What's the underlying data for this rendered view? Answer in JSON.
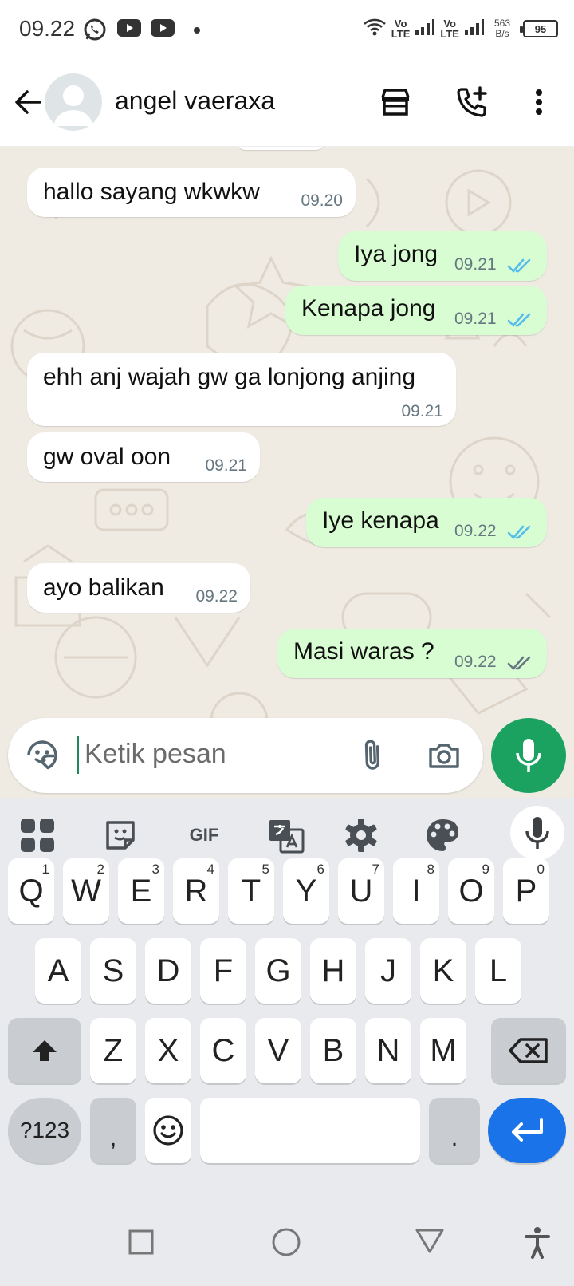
{
  "status_bar": {
    "time": "09.22",
    "volte1": "Vo",
    "lte1": "LTE",
    "volte2": "Vo",
    "lte2": "LTE",
    "net_speed_value": "563",
    "net_speed_unit": "B/s",
    "battery": "95",
    "notification_icons": [
      "whatsapp-icon",
      "youtube-icon",
      "youtube-icon",
      "dot-icon"
    ]
  },
  "header": {
    "contact_name": "angel vaeraxa",
    "icons": [
      "back-arrow-icon",
      "avatar-icon",
      "store-icon",
      "add-call-icon",
      "more-vert-icon"
    ]
  },
  "messages": [
    {
      "direction": "in",
      "text": "hallo sayang wkwkw",
      "time": "09.20"
    },
    {
      "direction": "out",
      "text": "Iya jong",
      "time": "09.21",
      "status": "read"
    },
    {
      "direction": "out",
      "text": "Kenapa jong",
      "time": "09.21",
      "status": "read"
    },
    {
      "direction": "in",
      "text": "ehh anj wajah gw ga lonjong anjing",
      "time": "09.21"
    },
    {
      "direction": "in",
      "text": "gw oval oon",
      "time": "09.21"
    },
    {
      "direction": "out",
      "text": "Iye kenapa",
      "time": "09.22",
      "status": "read"
    },
    {
      "direction": "in",
      "text": "ayo balikan",
      "time": "09.22"
    },
    {
      "direction": "out",
      "text": "Masi waras ?",
      "time": "09.22",
      "status": "delivered"
    }
  ],
  "composer": {
    "placeholder": "Ketik pesan",
    "icons": [
      "sticker-icon",
      "attach-icon",
      "camera-icon",
      "mic-icon"
    ]
  },
  "keyboard": {
    "toolbar_gif": "GIF",
    "toolbar_icons": [
      "apps-grid-icon",
      "sticker-icon",
      "gif-icon",
      "translate-icon",
      "settings-gear-icon",
      "palette-icon",
      "mic-icon"
    ],
    "row1": [
      {
        "k": "Q",
        "n": "1"
      },
      {
        "k": "W",
        "n": "2"
      },
      {
        "k": "E",
        "n": "3"
      },
      {
        "k": "R",
        "n": "4"
      },
      {
        "k": "T",
        "n": "5"
      },
      {
        "k": "Y",
        "n": "6"
      },
      {
        "k": "U",
        "n": "7"
      },
      {
        "k": "I",
        "n": "8"
      },
      {
        "k": "O",
        "n": "9"
      },
      {
        "k": "P",
        "n": "0"
      }
    ],
    "row2": [
      "A",
      "S",
      "D",
      "F",
      "G",
      "H",
      "J",
      "K",
      "L"
    ],
    "row3": [
      "Z",
      "X",
      "C",
      "V",
      "B",
      "N",
      "M"
    ],
    "symbols_key": "?123",
    "comma_key": ",",
    "period_key": ".",
    "special_icons": [
      "shift-icon",
      "backspace-icon",
      "emoji-icon",
      "enter-icon"
    ]
  },
  "nav_bar": {
    "icons": [
      "recents-square-icon",
      "home-circle-icon",
      "back-triangle-icon",
      "accessibility-icon"
    ]
  },
  "colors": {
    "chat_background": "#efeae2",
    "incoming_bubble": "#ffffff",
    "outgoing_bubble": "#d9fdd3",
    "read_ticks": "#53bdeb",
    "delivered_ticks": "#667781",
    "mic_button": "#1ba160",
    "enter_key": "#1a73e8"
  }
}
